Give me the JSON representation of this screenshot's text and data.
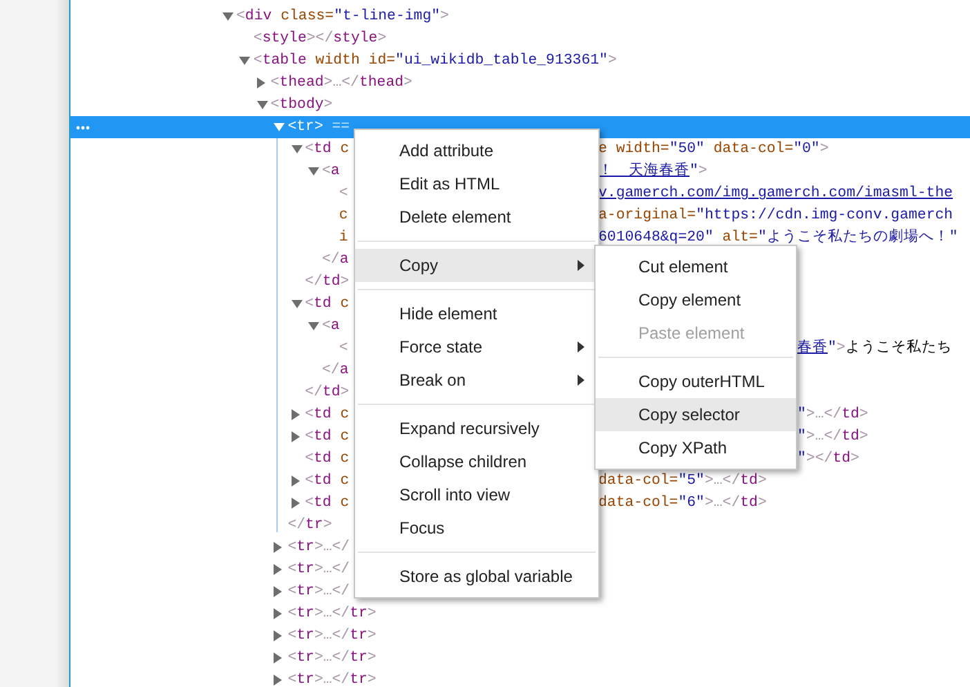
{
  "tree": [
    {
      "selected": false,
      "expanded": true,
      "lines": [
        {
          "left": [
            {
              "kind": "bracket",
              "text": "<"
            },
            {
              "kind": "tag",
              "text": "div"
            },
            {
              "kind": "attr",
              "text": " class="
            },
            {
              "kind": "value",
              "text": "\"t-line-img\""
            },
            {
              "kind": "bracket",
              "text": ">"
            }
          ]
        }
      ],
      "children": [
        {
          "selected": false,
          "lines": [
            {
              "left": [
                {
                  "kind": "bracket",
                  "text": "<"
                },
                {
                  "kind": "tag",
                  "text": "style"
                },
                {
                  "kind": "bracket",
                  "text": "></"
                },
                {
                  "kind": "tag",
                  "text": "style"
                },
                {
                  "kind": "bracket",
                  "text": ">"
                }
              ]
            }
          ]
        },
        {
          "selected": false,
          "expanded": true,
          "lines": [
            {
              "left": [
                {
                  "kind": "bracket",
                  "text": "<"
                },
                {
                  "kind": "tag",
                  "text": "table"
                },
                {
                  "kind": "attr",
                  "text": " width id="
                },
                {
                  "kind": "value",
                  "text": "\"ui_wikidb_table_913361\""
                },
                {
                  "kind": "bracket",
                  "text": ">"
                }
              ]
            }
          ],
          "children": [
            {
              "selected": false,
              "expanded": false,
              "lines": [
                {
                  "left": [
                    {
                      "kind": "bracket",
                      "text": "<"
                    },
                    {
                      "kind": "tag",
                      "text": "thead"
                    },
                    {
                      "kind": "bracket",
                      "text": ">…</"
                    },
                    {
                      "kind": "tag",
                      "text": "thead"
                    },
                    {
                      "kind": "bracket",
                      "text": ">"
                    }
                  ]
                }
              ]
            },
            {
              "selected": false,
              "expanded": true,
              "lines": [
                {
                  "left": [
                    {
                      "kind": "bracket",
                      "text": "<"
                    },
                    {
                      "kind": "tag",
                      "text": "tbody"
                    },
                    {
                      "kind": "bracket",
                      "text": ">"
                    }
                  ]
                }
              ],
              "children": [
                {
                  "selected": true,
                  "expanded": true,
                  "lines": [
                    {
                      "left": [
                        {
                          "kind": "bracket",
                          "text": "<"
                        },
                        {
                          "kind": "tag",
                          "text": "tr"
                        },
                        {
                          "kind": "bracket",
                          "text": ">"
                        },
                        {
                          "kind": "marker",
                          "text": " =="
                        }
                      ]
                    }
                  ],
                  "children": [
                    {
                      "selected": false,
                      "expanded": true,
                      "lines": [
                        {
                          "left": [
                            {
                              "kind": "bracket",
                              "text": "<"
                            },
                            {
                              "kind": "tag",
                              "text": "td"
                            },
                            {
                              "kind": "attr",
                              "text": " c"
                            }
                          ],
                          "past_submenu": false,
                          "right": [
                            {
                              "kind": "attr",
                              "text": "e width="
                            },
                            {
                              "kind": "value",
                              "text": "\"50\""
                            },
                            {
                              "kind": "attr",
                              "text": " data-col="
                            },
                            {
                              "kind": "value",
                              "text": "\"0\""
                            },
                            {
                              "kind": "bracket",
                              "text": ">"
                            }
                          ]
                        }
                      ],
                      "children": [
                        {
                          "selected": false,
                          "expanded": true,
                          "lines": [
                            {
                              "left": [
                                {
                                  "kind": "bracket",
                                  "text": "<"
                                },
                                {
                                  "kind": "tag",
                                  "text": "a"
                                }
                              ],
                              "past_submenu": false,
                              "right": [
                                {
                                  "kind": "link",
                                  "text": "！　天海春香"
                                },
                                {
                                  "kind": "value",
                                  "text": "\""
                                },
                                {
                                  "kind": "bracket",
                                  "text": ">"
                                }
                              ]
                            }
                          ],
                          "children": [
                            {
                              "selected": false,
                              "lines": [
                                {
                                  "left": [
                                    {
                                      "kind": "bracket",
                                      "text": "<"
                                    }
                                  ],
                                  "past_submenu": false,
                                  "right": [
                                    {
                                      "kind": "link",
                                      "text": "v.gamerch.com/img.gamerch.com/imasml-the"
                                    }
                                  ]
                                },
                                {
                                  "left": [
                                    {
                                      "kind": "attr",
                                      "text": "c"
                                    }
                                  ],
                                  "past_submenu": false,
                                  "right": [
                                    {
                                      "kind": "attr",
                                      "text": "a-original="
                                    },
                                    {
                                      "kind": "value",
                                      "text": "\"https://cdn.img-conv.gamerch"
                                    }
                                  ]
                                },
                                {
                                  "left": [
                                    {
                                      "kind": "attr",
                                      "text": "i"
                                    }
                                  ],
                                  "past_submenu": false,
                                  "right": [
                                    {
                                      "kind": "value",
                                      "text": "6010648&q=20\""
                                    },
                                    {
                                      "kind": "attr",
                                      "text": " alt="
                                    },
                                    {
                                      "kind": "value",
                                      "text": "\"ようこそ私たちの劇場へ！\""
                                    }
                                  ]
                                }
                              ]
                            }
                          ],
                          "close": [
                            {
                              "kind": "bracket",
                              "text": "</"
                            },
                            {
                              "kind": "tag",
                              "text": "a"
                            }
                          ]
                        }
                      ],
                      "close": [
                        {
                          "kind": "bracket",
                          "text": "</"
                        },
                        {
                          "kind": "tag",
                          "text": "td"
                        },
                        {
                          "kind": "bracket",
                          "text": ">"
                        }
                      ]
                    },
                    {
                      "selected": false,
                      "expanded": true,
                      "lines": [
                        {
                          "left": [
                            {
                              "kind": "bracket",
                              "text": "<"
                            },
                            {
                              "kind": "tag",
                              "text": "td"
                            },
                            {
                              "kind": "attr",
                              "text": " c"
                            }
                          ]
                        }
                      ],
                      "children": [
                        {
                          "selected": false,
                          "expanded": true,
                          "lines": [
                            {
                              "left": [
                                {
                                  "kind": "bracket",
                                  "text": "<"
                                },
                                {
                                  "kind": "tag",
                                  "text": "a"
                                }
                              ]
                            }
                          ],
                          "children": [
                            {
                              "selected": false,
                              "lines": [
                                {
                                  "left": [
                                    {
                                      "kind": "bracket",
                                      "text": "<"
                                    }
                                  ],
                                  "past_submenu": true,
                                  "right": [
                                    {
                                      "kind": "link",
                                      "text": "春香"
                                    },
                                    {
                                      "kind": "value",
                                      "text": "\""
                                    },
                                    {
                                      "kind": "bracket",
                                      "text": ">"
                                    },
                                    {
                                      "kind": "text",
                                      "text": "ようこそ私たち"
                                    }
                                  ]
                                }
                              ]
                            }
                          ],
                          "close": [
                            {
                              "kind": "bracket",
                              "text": "</"
                            },
                            {
                              "kind": "tag",
                              "text": "a"
                            }
                          ]
                        }
                      ],
                      "close": [
                        {
                          "kind": "bracket",
                          "text": "</"
                        },
                        {
                          "kind": "tag",
                          "text": "td"
                        },
                        {
                          "kind": "bracket",
                          "text": ">"
                        }
                      ]
                    },
                    {
                      "selected": false,
                      "expanded": false,
                      "lines": [
                        {
                          "left": [
                            {
                              "kind": "bracket",
                              "text": "<"
                            },
                            {
                              "kind": "tag",
                              "text": "td"
                            },
                            {
                              "kind": "attr",
                              "text": " c"
                            }
                          ],
                          "past_submenu": true,
                          "right": [
                            {
                              "kind": "value",
                              "text": "\""
                            },
                            {
                              "kind": "bracket",
                              "text": ">…</"
                            },
                            {
                              "kind": "tag",
                              "text": "td"
                            },
                            {
                              "kind": "bracket",
                              "text": ">"
                            }
                          ]
                        }
                      ]
                    },
                    {
                      "selected": false,
                      "expanded": false,
                      "lines": [
                        {
                          "left": [
                            {
                              "kind": "bracket",
                              "text": "<"
                            },
                            {
                              "kind": "tag",
                              "text": "td"
                            },
                            {
                              "kind": "attr",
                              "text": " c"
                            }
                          ],
                          "past_submenu": true,
                          "right": [
                            {
                              "kind": "value",
                              "text": "\""
                            },
                            {
                              "kind": "bracket",
                              "text": ">…</"
                            },
                            {
                              "kind": "tag",
                              "text": "td"
                            },
                            {
                              "kind": "bracket",
                              "text": ">"
                            }
                          ]
                        }
                      ]
                    },
                    {
                      "selected": false,
                      "lines": [
                        {
                          "left": [
                            {
                              "kind": "bracket",
                              "text": "<"
                            },
                            {
                              "kind": "tag",
                              "text": "td"
                            },
                            {
                              "kind": "attr",
                              "text": " c"
                            }
                          ],
                          "past_submenu": true,
                          "right": [
                            {
                              "kind": "value",
                              "text": "\""
                            },
                            {
                              "kind": "bracket",
                              "text": "></"
                            },
                            {
                              "kind": "tag",
                              "text": "td"
                            },
                            {
                              "kind": "bracket",
                              "text": ">"
                            }
                          ]
                        }
                      ]
                    },
                    {
                      "selected": false,
                      "expanded": false,
                      "lines": [
                        {
                          "left": [
                            {
                              "kind": "bracket",
                              "text": "<"
                            },
                            {
                              "kind": "tag",
                              "text": "td"
                            },
                            {
                              "kind": "attr",
                              "text": " c"
                            }
                          ],
                          "past_submenu": false,
                          "right": [
                            {
                              "kind": "attr",
                              "text": "data-col="
                            },
                            {
                              "kind": "value",
                              "text": "\"5\""
                            },
                            {
                              "kind": "bracket",
                              "text": ">…</"
                            },
                            {
                              "kind": "tag",
                              "text": "td"
                            },
                            {
                              "kind": "bracket",
                              "text": ">"
                            }
                          ]
                        }
                      ]
                    },
                    {
                      "selected": false,
                      "expanded": false,
                      "lines": [
                        {
                          "left": [
                            {
                              "kind": "bracket",
                              "text": "<"
                            },
                            {
                              "kind": "tag",
                              "text": "td"
                            },
                            {
                              "kind": "attr",
                              "text": " c"
                            }
                          ],
                          "past_submenu": false,
                          "right": [
                            {
                              "kind": "attr",
                              "text": "data-col="
                            },
                            {
                              "kind": "value",
                              "text": "\"6\""
                            },
                            {
                              "kind": "bracket",
                              "text": ">…</"
                            },
                            {
                              "kind": "tag",
                              "text": "td"
                            },
                            {
                              "kind": "bracket",
                              "text": ">"
                            }
                          ]
                        }
                      ]
                    }
                  ],
                  "close": [
                    {
                      "kind": "bracket",
                      "text": "</"
                    },
                    {
                      "kind": "tag",
                      "text": "tr"
                    },
                    {
                      "kind": "bracket",
                      "text": ">"
                    }
                  ]
                },
                {
                  "selected": false,
                  "expanded": false,
                  "lines": [
                    {
                      "left": [
                        {
                          "kind": "bracket",
                          "text": "<"
                        },
                        {
                          "kind": "tag",
                          "text": "tr"
                        },
                        {
                          "kind": "bracket",
                          "text": ">…</"
                        }
                      ]
                    }
                  ]
                },
                {
                  "selected": false,
                  "expanded": false,
                  "lines": [
                    {
                      "left": [
                        {
                          "kind": "bracket",
                          "text": "<"
                        },
                        {
                          "kind": "tag",
                          "text": "tr"
                        },
                        {
                          "kind": "bracket",
                          "text": ">…</"
                        }
                      ]
                    }
                  ]
                },
                {
                  "selected": false,
                  "expanded": false,
                  "lines": [
                    {
                      "left": [
                        {
                          "kind": "bracket",
                          "text": "<"
                        },
                        {
                          "kind": "tag",
                          "text": "tr"
                        },
                        {
                          "kind": "bracket",
                          "text": ">…</"
                        }
                      ]
                    }
                  ]
                },
                {
                  "selected": false,
                  "expanded": false,
                  "lines": [
                    {
                      "left": [
                        {
                          "kind": "bracket",
                          "text": "<"
                        },
                        {
                          "kind": "tag",
                          "text": "tr"
                        },
                        {
                          "kind": "bracket",
                          "text": ">…</"
                        },
                        {
                          "kind": "tag",
                          "text": "tr"
                        },
                        {
                          "kind": "bracket",
                          "text": ">"
                        }
                      ]
                    }
                  ]
                },
                {
                  "selected": false,
                  "expanded": false,
                  "lines": [
                    {
                      "left": [
                        {
                          "kind": "bracket",
                          "text": "<"
                        },
                        {
                          "kind": "tag",
                          "text": "tr"
                        },
                        {
                          "kind": "bracket",
                          "text": ">…</"
                        },
                        {
                          "kind": "tag",
                          "text": "tr"
                        },
                        {
                          "kind": "bracket",
                          "text": ">"
                        }
                      ]
                    }
                  ]
                },
                {
                  "selected": false,
                  "expanded": false,
                  "lines": [
                    {
                      "left": [
                        {
                          "kind": "bracket",
                          "text": "<"
                        },
                        {
                          "kind": "tag",
                          "text": "tr"
                        },
                        {
                          "kind": "bracket",
                          "text": ">…</"
                        },
                        {
                          "kind": "tag",
                          "text": "tr"
                        },
                        {
                          "kind": "bracket",
                          "text": ">"
                        }
                      ]
                    }
                  ]
                },
                {
                  "selected": false,
                  "expanded": false,
                  "lines": [
                    {
                      "left": [
                        {
                          "kind": "bracket",
                          "text": "<"
                        },
                        {
                          "kind": "tag",
                          "text": "tr"
                        },
                        {
                          "kind": "bracket",
                          "text": ">…</"
                        },
                        {
                          "kind": "tag",
                          "text": "tr"
                        },
                        {
                          "kind": "bracket",
                          "text": ">"
                        }
                      ]
                    }
                  ]
                }
              ]
            }
          ]
        }
      ]
    }
  ],
  "context_menu": {
    "items": [
      {
        "kind": "item",
        "label": "Add attribute",
        "highlighted": false,
        "disabled": false,
        "submenu": false
      },
      {
        "kind": "item",
        "label": "Edit as HTML",
        "highlighted": false,
        "disabled": false,
        "submenu": false
      },
      {
        "kind": "item",
        "label": "Delete element",
        "highlighted": false,
        "disabled": false,
        "submenu": false
      },
      {
        "kind": "separator"
      },
      {
        "kind": "item",
        "label": "Copy",
        "highlighted": true,
        "disabled": false,
        "submenu": true
      },
      {
        "kind": "separator"
      },
      {
        "kind": "item",
        "label": "Hide element",
        "highlighted": false,
        "disabled": false,
        "submenu": false
      },
      {
        "kind": "item",
        "label": "Force state",
        "highlighted": false,
        "disabled": false,
        "submenu": true
      },
      {
        "kind": "item",
        "label": "Break on",
        "highlighted": false,
        "disabled": false,
        "submenu": true
      },
      {
        "kind": "separator"
      },
      {
        "kind": "item",
        "label": "Expand recursively",
        "highlighted": false,
        "disabled": false,
        "submenu": false
      },
      {
        "kind": "item",
        "label": "Collapse children",
        "highlighted": false,
        "disabled": false,
        "submenu": false
      },
      {
        "kind": "item",
        "label": "Scroll into view",
        "highlighted": false,
        "disabled": false,
        "submenu": false
      },
      {
        "kind": "item",
        "label": "Focus",
        "highlighted": false,
        "disabled": false,
        "submenu": false
      },
      {
        "kind": "separator"
      },
      {
        "kind": "item",
        "label": "Store as global variable",
        "highlighted": false,
        "disabled": false,
        "submenu": false
      }
    ]
  },
  "submenu": {
    "items": [
      {
        "kind": "item",
        "label": "Cut element",
        "highlighted": false,
        "disabled": false,
        "submenu": false
      },
      {
        "kind": "item",
        "label": "Copy element",
        "highlighted": false,
        "disabled": false,
        "submenu": false
      },
      {
        "kind": "item",
        "label": "Paste element",
        "highlighted": false,
        "disabled": true,
        "submenu": false
      },
      {
        "kind": "separator"
      },
      {
        "kind": "item",
        "label": "Copy outerHTML",
        "highlighted": false,
        "disabled": false,
        "submenu": false
      },
      {
        "kind": "item",
        "label": "Copy selector",
        "highlighted": true,
        "disabled": false,
        "submenu": false
      },
      {
        "kind": "item",
        "label": "Copy XPath",
        "highlighted": false,
        "disabled": false,
        "submenu": false
      }
    ]
  }
}
